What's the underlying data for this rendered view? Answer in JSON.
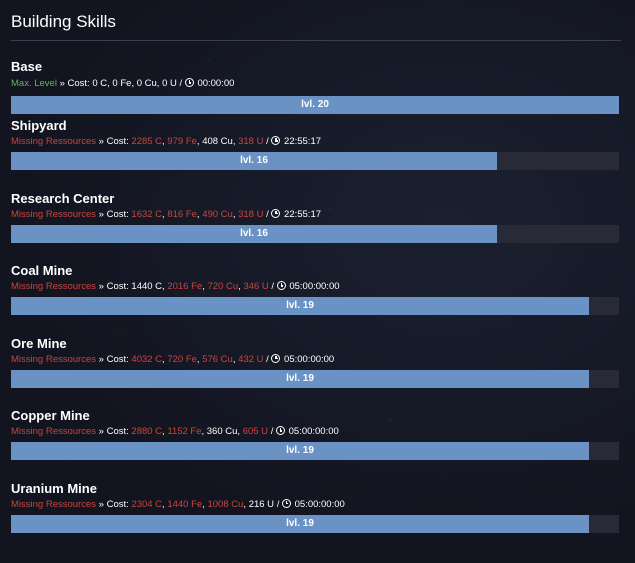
{
  "panel": {
    "title": "Building Skills"
  },
  "labels": {
    "separator": "»",
    "cost_prefix": "Cost:",
    "slash": "/"
  },
  "colors": {
    "ok": "#5cb85c",
    "missing": "#c9453e",
    "bar_fill": "#6a92c4",
    "bar_track": "#282b37"
  },
  "skills": [
    {
      "name": "Base",
      "status": "Max. Level",
      "status_type": "ok",
      "cost": [
        {
          "text": "0 C",
          "missing": false
        },
        {
          "text": "0 Fe",
          "missing": false
        },
        {
          "text": "0 Cu",
          "missing": false
        },
        {
          "text": "0 U",
          "missing": false
        }
      ],
      "time": "00:00:00",
      "level_label": "lvl. 20",
      "progress": 1.0
    },
    {
      "name": "Shipyard",
      "status": "Missing Ressources",
      "status_type": "missing",
      "cost": [
        {
          "text": "2285 C",
          "missing": true
        },
        {
          "text": "979 Fe",
          "missing": true
        },
        {
          "text": "408 Cu",
          "missing": false
        },
        {
          "text": "318 U",
          "missing": true
        }
      ],
      "time": "22:55:17",
      "level_label": "lvl. 16",
      "progress": 0.8
    },
    {
      "name": "Research Center",
      "status": "Missing Ressources",
      "status_type": "missing",
      "cost": [
        {
          "text": "1632 C",
          "missing": true
        },
        {
          "text": "816 Fe",
          "missing": true
        },
        {
          "text": "490 Cu",
          "missing": true
        },
        {
          "text": "318 U",
          "missing": true
        }
      ],
      "time": "22:55:17",
      "level_label": "lvl. 16",
      "progress": 0.8
    },
    {
      "name": "Coal Mine",
      "status": "Missing Ressources",
      "status_type": "missing",
      "cost": [
        {
          "text": "1440 C",
          "missing": false
        },
        {
          "text": "2016 Fe",
          "missing": true
        },
        {
          "text": "720 Cu",
          "missing": true
        },
        {
          "text": "346 U",
          "missing": true
        }
      ],
      "time": "05:00:00:00",
      "level_label": "lvl. 19",
      "progress": 0.95
    },
    {
      "name": "Ore Mine",
      "status": "Missing Ressources",
      "status_type": "missing",
      "cost": [
        {
          "text": "4032 C",
          "missing": true
        },
        {
          "text": "720 Fe",
          "missing": true
        },
        {
          "text": "576 Cu",
          "missing": true
        },
        {
          "text": "432 U",
          "missing": true
        }
      ],
      "time": "05:00:00:00",
      "level_label": "lvl. 19",
      "progress": 0.95
    },
    {
      "name": "Copper Mine",
      "status": "Missing Ressources",
      "status_type": "missing",
      "cost": [
        {
          "text": "2880 C",
          "missing": true
        },
        {
          "text": "1152 Fe",
          "missing": true
        },
        {
          "text": "360 Cu",
          "missing": false
        },
        {
          "text": "605 U",
          "missing": true
        }
      ],
      "time": "05:00:00:00",
      "level_label": "lvl. 19",
      "progress": 0.95
    },
    {
      "name": "Uranium Mine",
      "status": "Missing Ressources",
      "status_type": "missing",
      "cost": [
        {
          "text": "2304 C",
          "missing": true
        },
        {
          "text": "1440 Fe",
          "missing": true
        },
        {
          "text": "1008 Cu",
          "missing": true
        },
        {
          "text": "216 U",
          "missing": false
        }
      ],
      "time": "05:00:00:00",
      "level_label": "lvl. 19",
      "progress": 0.95
    }
  ]
}
